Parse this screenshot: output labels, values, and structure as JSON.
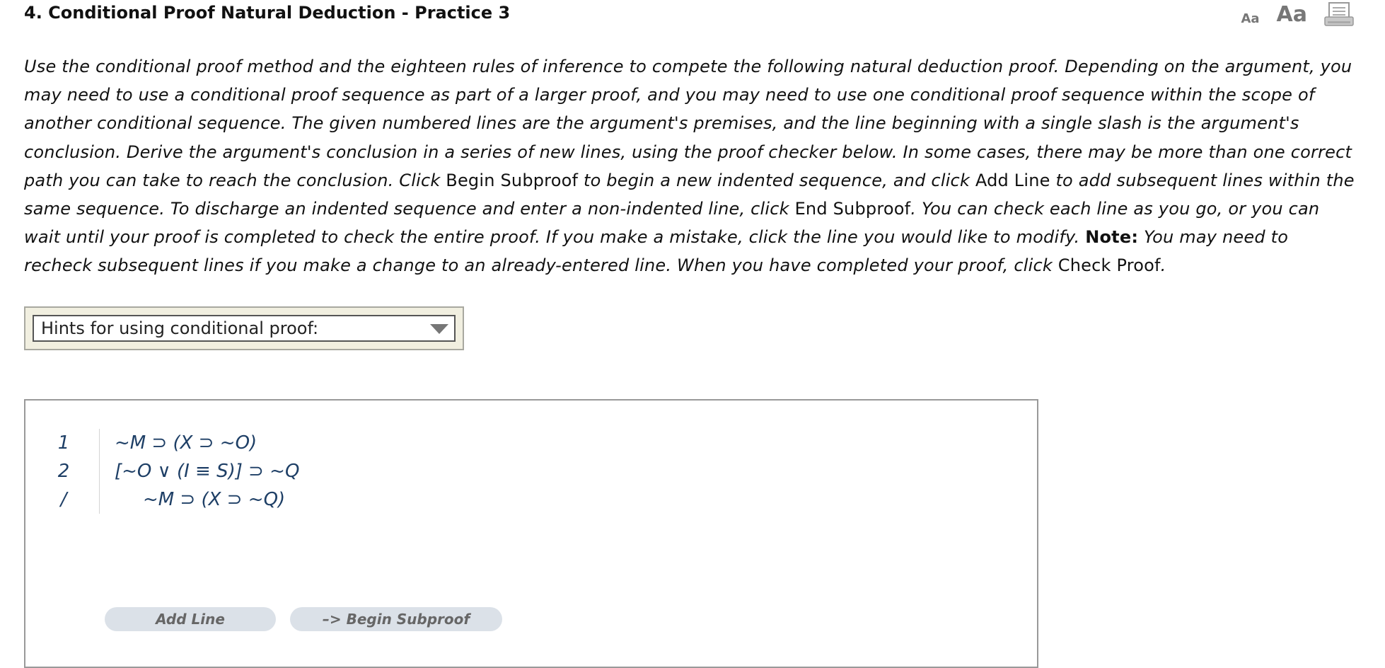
{
  "header": {
    "title": "4.  Conditional Proof Natural Deduction - Practice 3",
    "font_small_label": "Aa",
    "font_large_label": "Aa",
    "print_icon": "print-icon"
  },
  "instructions": {
    "p1": "Use the conditional proof method and the eighteen rules of inference to compete the following natural deduction proof. Depending on the argument, you may need to use a conditional proof sequence as part of a larger proof, and you may need to use one conditional proof sequence within the scope of another conditional sequence. The given numbered lines are the argument's premises, and the line beginning with a single slash is the argument's conclusion. Derive the argument's conclusion in a series of new lines, using the proof checker below. In some cases, there may be more than one correct path you can take to reach the conclusion. Click ",
    "begin_subproof": "Begin Subproof",
    "p2": " to begin a new indented sequence, and click ",
    "add_line": "Add Line",
    "p3": " to add subsequent lines within the same sequence. To discharge an indented sequence and enter a non-indented line, click ",
    "end_subproof": "End Subproof",
    "p4": ". You can check each line as you go, or you can wait until your proof is completed to check the entire proof. If you make a mistake, click the line you would like to modify. ",
    "note_label": "Note:",
    "p5": " You may need to recheck subsequent lines if you make a change to an already-entered line. When you have completed your proof, click ",
    "check_proof": "Check Proof",
    "p6": "."
  },
  "hints": {
    "selected": "Hints for using conditional proof:"
  },
  "proof": {
    "lines": [
      {
        "num": "1",
        "formula": "~M ⊃ (X ⊃ ~O)"
      },
      {
        "num": "2",
        "formula": "[~O ∨ (I ≡ S)] ⊃ ~Q"
      },
      {
        "num": "/",
        "formula": "~M ⊃ (X ⊃ ~Q)"
      }
    ],
    "add_line_label": "Add Line",
    "begin_subproof_label": "–>  Begin Subproof"
  }
}
